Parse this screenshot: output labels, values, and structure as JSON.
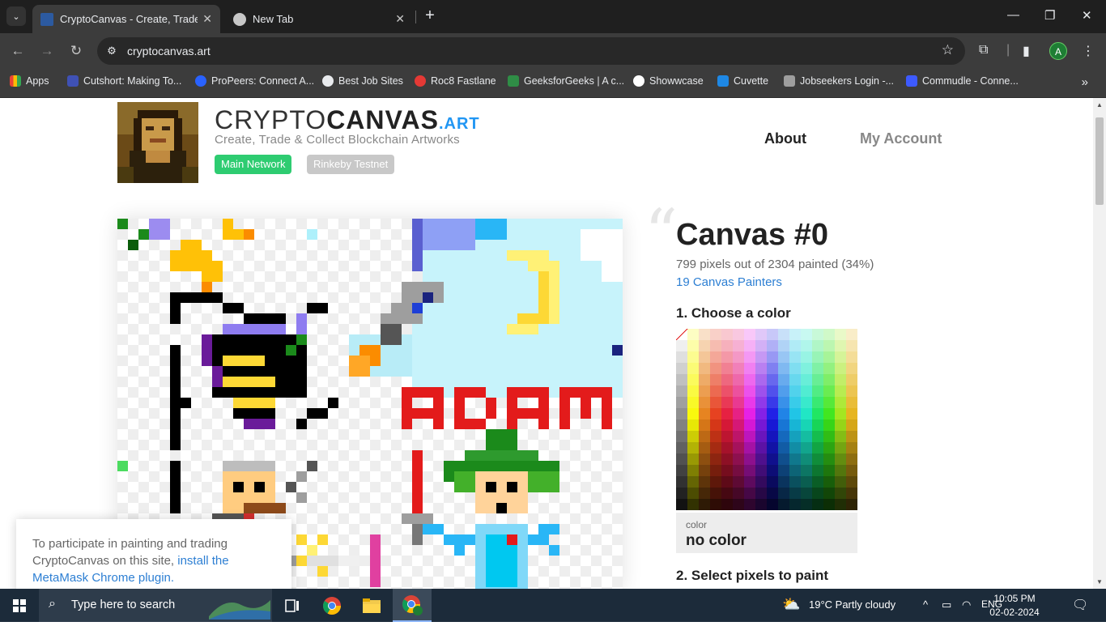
{
  "browser": {
    "tabs": [
      {
        "title": "CryptoCanvas - Create, Trade & Collect Blockchain Artworks",
        "active": true
      },
      {
        "title": "New Tab",
        "active": false
      }
    ],
    "url": "cryptocanvas.art",
    "profile_initial": "A",
    "bookmarks": [
      {
        "label": "Apps",
        "color": "#ea4335"
      },
      {
        "label": "Cutshort: Making To...",
        "color": "#3f51b5"
      },
      {
        "label": "ProPeers: Connect A...",
        "color": "#2962ff"
      },
      {
        "label": "Best Job Sites",
        "color": "#ffffff"
      },
      {
        "label": "Roc8 Fastlane",
        "color": "#e53935"
      },
      {
        "label": "GeeksforGeeks | A c...",
        "color": "#2f8d46"
      },
      {
        "label": "Showwcase",
        "color": "#ffffff"
      },
      {
        "label": "Cuvette",
        "color": "#1e88e5"
      },
      {
        "label": "Jobseekers Login -...",
        "color": "#e8eaed"
      },
      {
        "label": "Commudle - Conne...",
        "color": "#3d5afe"
      }
    ]
  },
  "site": {
    "brand_thin": "CRYPTO",
    "brand_bold": "CANVAS",
    "brand_tld": ".ART",
    "tagline": "Create, Trade & Collect Blockchain Artworks",
    "networks": {
      "main": "Main Network",
      "test": "Rinkeby Testnet"
    },
    "nav": {
      "about": "About",
      "account": "My Account"
    }
  },
  "canvas": {
    "title": "Canvas #0",
    "painted_text": "799 pixels out of 2304 painted (34%)",
    "painters_text": "19 Canvas Painters",
    "painted": 799,
    "total": 2304,
    "step1": "1. Choose a color",
    "color_label": "color",
    "color_value": "no color",
    "step2": "2. Select pixels to paint"
  },
  "notice": {
    "text": "To participate in painting and trading CryptoCanvas on this site,",
    "link": "install the MetaMask Chrome plugin."
  },
  "taskbar": {
    "search_placeholder": "Type here to search",
    "weather": "19°C  Partly cloudy",
    "lang": "ENG",
    "time": "10:05 PM",
    "date": "02-02-2024"
  }
}
